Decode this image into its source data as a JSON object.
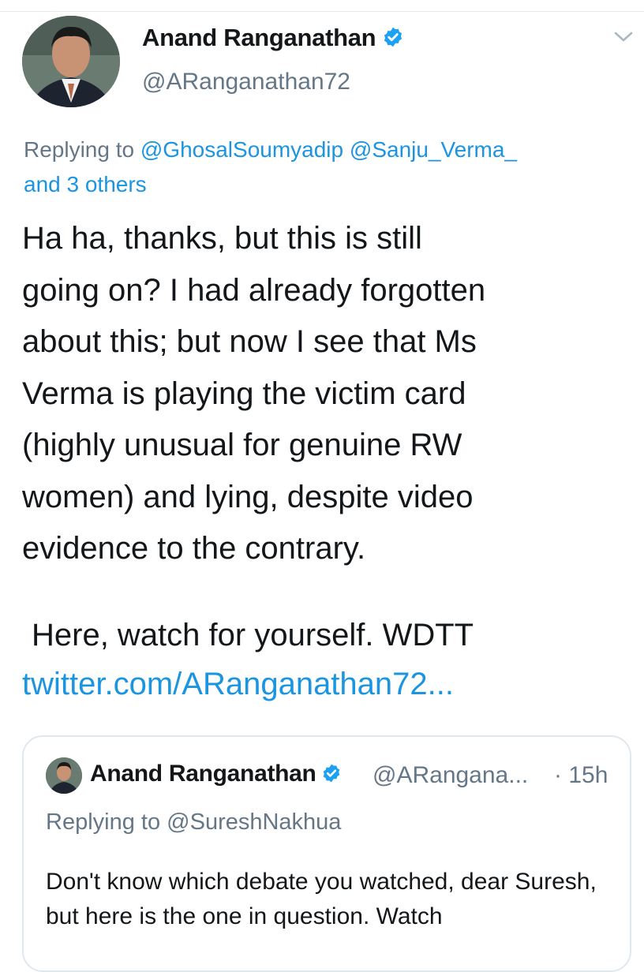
{
  "author": {
    "name": "Anand Ranganathan",
    "handle": "@ARanganathan72",
    "verified_badge_icon": "verified-badge-icon"
  },
  "menu": {
    "icon": "chevron-down-icon"
  },
  "reply_context": {
    "prefix": "Replying to",
    "mention_1": "@GhosalSoumyadip",
    "mention_2": "@Sanju_Verma_",
    "others": "and 3 others"
  },
  "tweet": {
    "body": "Ha ha, thanks, but this is still\ngoing on? I had already forgotten\nabout this; but now I see that Ms\nVerma is playing the victim card\n(highly unusual for genuine RW\nwomen) and lying, despite video\nevidence to the contrary.",
    "watch_line": "Here, watch for yourself. WDTT",
    "link": "twitter.com/ARanganathan72..."
  },
  "quoted_tweet": {
    "name": "Anand Ranganathan",
    "handle": "@ARangana...",
    "time": "· 15h",
    "reply_prefix": "Replying to",
    "reply_mention": "@SureshNakhua",
    "body": "Don't know which debate you watched, dear Suresh, but here is the one in question. Watch"
  },
  "colors": {
    "link_blue": "#1b95e0",
    "muted_gray": "#657786",
    "text_dark": "#14171a",
    "card_border": "#e1e8ed"
  }
}
